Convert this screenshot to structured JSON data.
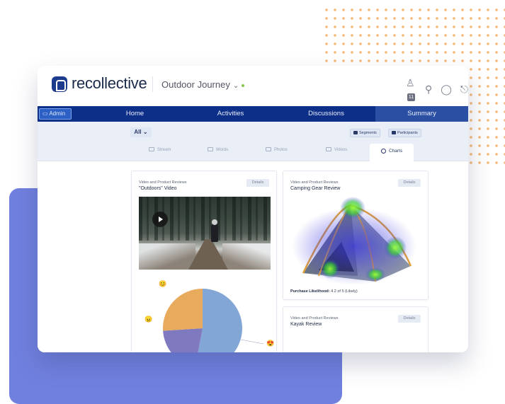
{
  "logo": {
    "text": "recollective"
  },
  "header": {
    "project": "Outdoor Journey",
    "project_chevron": "⌄"
  },
  "header_icons": {
    "user_icon": "user-icon",
    "badge": "11",
    "search_icon": "search-icon",
    "chat_icon": "chat-icon"
  },
  "nav": {
    "admin_label": "Admin",
    "items": [
      {
        "label": "Home"
      },
      {
        "label": "Activities"
      },
      {
        "label": "Discussions"
      },
      {
        "label": "Summary"
      }
    ]
  },
  "filters": {
    "all_label": "All",
    "segments_label": "Segments",
    "participants_label": "Participants"
  },
  "tabs": [
    {
      "label": "Stream"
    },
    {
      "label": "Words"
    },
    {
      "label": "Photos"
    },
    {
      "label": "Videos"
    },
    {
      "label": "Charts"
    }
  ],
  "cards": [
    {
      "category": "Video and Product Reviews",
      "title": "\"Outdoors\" Video",
      "details": "Details"
    },
    {
      "category": "Video and Product Reviews",
      "title": "Camping Gear Review",
      "details": "Details",
      "purchase_label": "Purchase Likelihood:",
      "purchase_value": "4.2 of 5 (Likely)"
    },
    {
      "category": "Video and Product Reviews",
      "title": "Kayak Review",
      "details": "Details"
    }
  ],
  "chart_data": {
    "type": "pie",
    "title": "",
    "values": [
      0.53,
      0.21,
      0.26
    ],
    "colors": [
      "#82a6d6",
      "#7f7ac0",
      "#e8aa5c"
    ],
    "markers": [
      "😠",
      "😍",
      "😊"
    ]
  },
  "colors": {
    "nav_bg": "#0d2f88",
    "accent": "#2a4fa3",
    "blob": "#7080de",
    "dots": "#f5b877"
  }
}
